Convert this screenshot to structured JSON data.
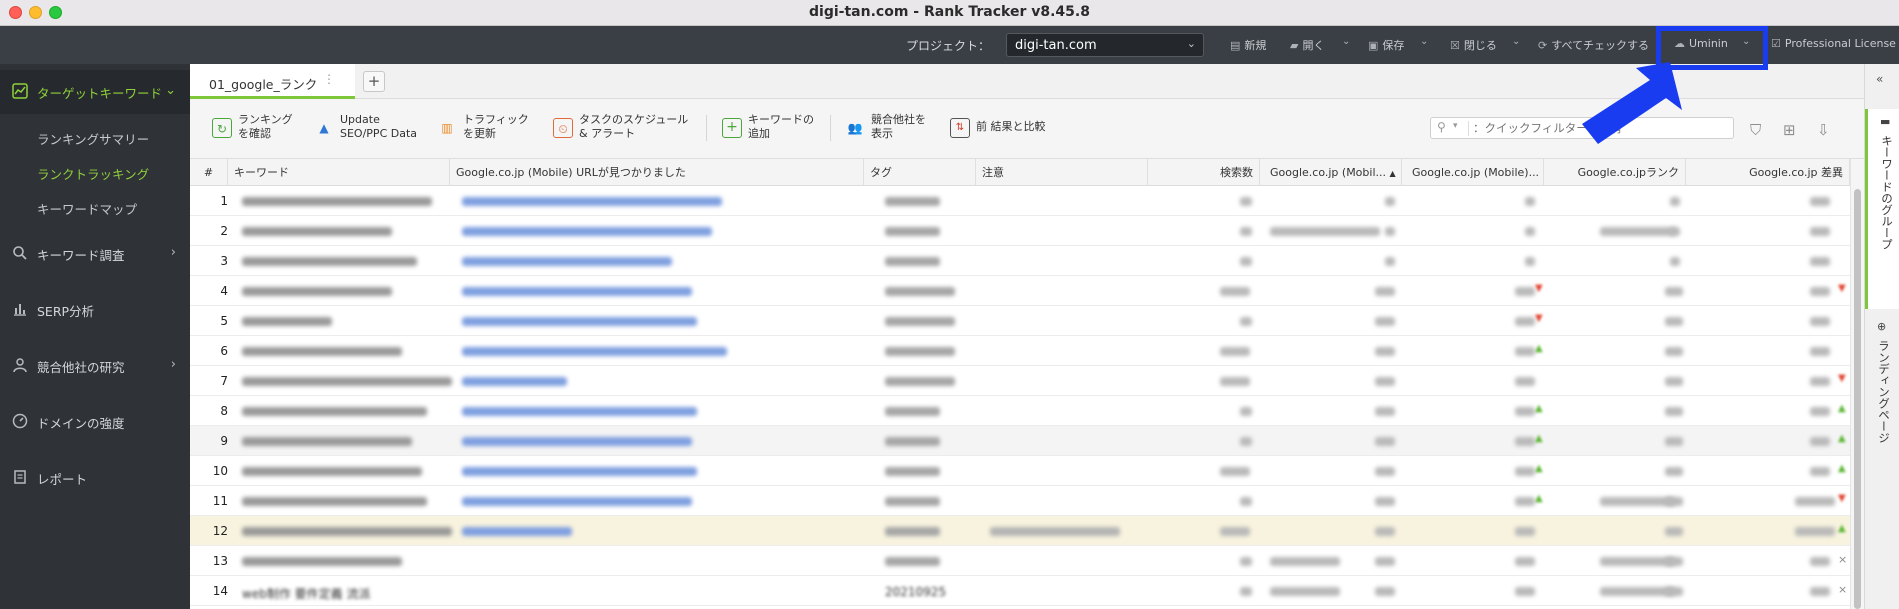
{
  "window": {
    "title": "digi-tan.com - Rank Tracker v8.45.8"
  },
  "project_bar": {
    "label": "プロジェクト：",
    "project": "digi-tan.com",
    "new": "新規",
    "open": "開く",
    "save": "保存",
    "close": "閉じる",
    "check_all": "すべてチェックする",
    "user": "Uminin",
    "license": "Professional License"
  },
  "sidebar": {
    "target_keywords": "ターゲットキーワード",
    "sub": [
      "ランキングサマリー",
      "ランクトラッキング",
      "キーワードマップ"
    ],
    "keyword_research": "キーワード調査",
    "serp": "SERP分析",
    "competitors": "競合他社の研究",
    "domain": "ドメインの強度",
    "reports": "レポート"
  },
  "tabs": {
    "active": "01_google_ランク"
  },
  "toolbar": {
    "check_rank": "ランキング\nを確認",
    "check_rank_1": "ランキング",
    "check_rank_2": "を確認",
    "update_1": "Update",
    "update_2": "SEO/PPC Data",
    "traffic_1": "トラフィック",
    "traffic_2": "を更新",
    "schedule_1": "タスクのスケジュール",
    "schedule_2": "& アラート",
    "add_kw_1": "キーワードの",
    "add_kw_2": "追加",
    "show_comp_1": "競合他社を",
    "show_comp_2": "表示",
    "compare": "前 結果と比較",
    "filter_placeholder": "：クイックフィルター：含有"
  },
  "table": {
    "headers": {
      "num": "#",
      "keyword": "キーワード",
      "url": "Google.co.jp (Mobile) URLが見つかりました",
      "tag": "タグ",
      "note": "注意",
      "volume": "検索数",
      "mobile_rank": "Google.co.jp (Mobil...",
      "mobile_diff": "Google.co.jp (Mobile)...",
      "rank": "Google.co.jpランク",
      "diff": "Google.co.jp 差異"
    },
    "sort_indicator": "▲",
    "row_numbers": [
      "1",
      "2",
      "3",
      "4",
      "5",
      "6",
      "7",
      "8",
      "9",
      "10",
      "11",
      "12",
      "13",
      "14"
    ],
    "row14_keyword": "web制作 要件定義 流派",
    "row14_tag": "20210925"
  },
  "right_rail": {
    "keyword_groups": "キーワードのグループ",
    "landing_pages": "ランディングページ"
  },
  "colors": {
    "accent": "#8fd13a",
    "annotation": "#1a3cf0"
  }
}
